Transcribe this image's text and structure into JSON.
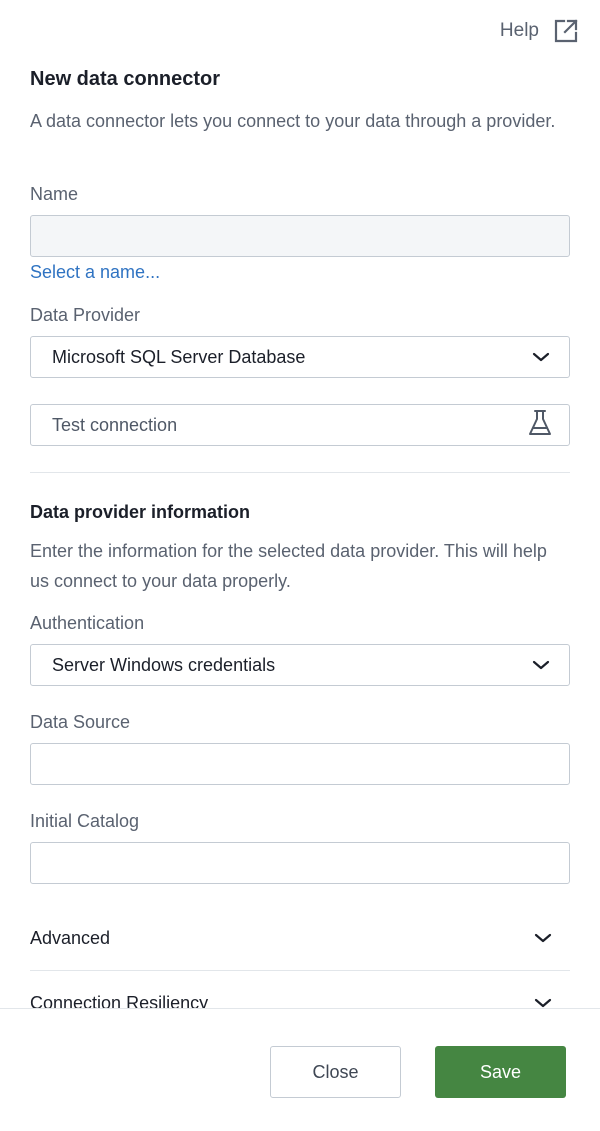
{
  "header": {
    "help_label": "Help",
    "help_icon": "external-link-icon"
  },
  "form": {
    "title": "New data connector",
    "description": "A data connector lets you connect to your data through a provider.",
    "name": {
      "label": "Name",
      "value": "",
      "select_link": "Select a name..."
    },
    "data_provider": {
      "label": "Data Provider",
      "selected": "Microsoft SQL Server Database"
    },
    "test_connection": {
      "label": "Test connection",
      "icon": "flask-icon"
    }
  },
  "provider_info": {
    "title": "Data provider information",
    "description": "Enter the information for the selected data provider. This will help us connect to your data properly.",
    "authentication": {
      "label": "Authentication",
      "selected": "Server Windows credentials"
    },
    "data_source": {
      "label": "Data Source",
      "value": ""
    },
    "initial_catalog": {
      "label": "Initial Catalog",
      "value": ""
    }
  },
  "accordions": [
    {
      "label": "Advanced",
      "icon": "chevron-down-icon"
    },
    {
      "label": "Connection Resiliency",
      "icon": "chevron-down-icon"
    }
  ],
  "footer": {
    "close_label": "Close",
    "save_label": "Save",
    "save_color": "#458642"
  }
}
